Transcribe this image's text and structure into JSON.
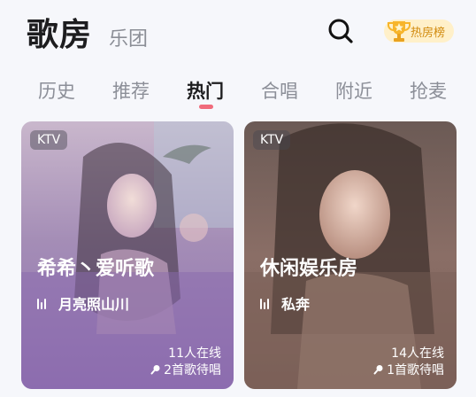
{
  "header": {
    "title": "歌房",
    "subtitle": "乐团",
    "rank_label": "热房榜",
    "icons": {
      "search": "search-icon",
      "trophy": "trophy-icon"
    }
  },
  "tabs": [
    {
      "label": "历史",
      "active": false
    },
    {
      "label": "推荐",
      "active": false
    },
    {
      "label": "热门",
      "active": true
    },
    {
      "label": "合唱",
      "active": false
    },
    {
      "label": "附近",
      "active": false
    },
    {
      "label": "抢麦",
      "active": false
    }
  ],
  "rooms": [
    {
      "badge": "KTV",
      "name": "希希丶爱听歌",
      "host": "月亮照山川",
      "online": "11人在线",
      "queue": "2首歌待唱"
    },
    {
      "badge": "KTV",
      "name": "休闲娱乐房",
      "host": "私奔",
      "online": "14人在线",
      "queue": "1首歌待唱"
    }
  ],
  "colors": {
    "accent": "#f06b7b",
    "rank_bg": "#fff0c9",
    "rank_text": "#d18a0d"
  }
}
